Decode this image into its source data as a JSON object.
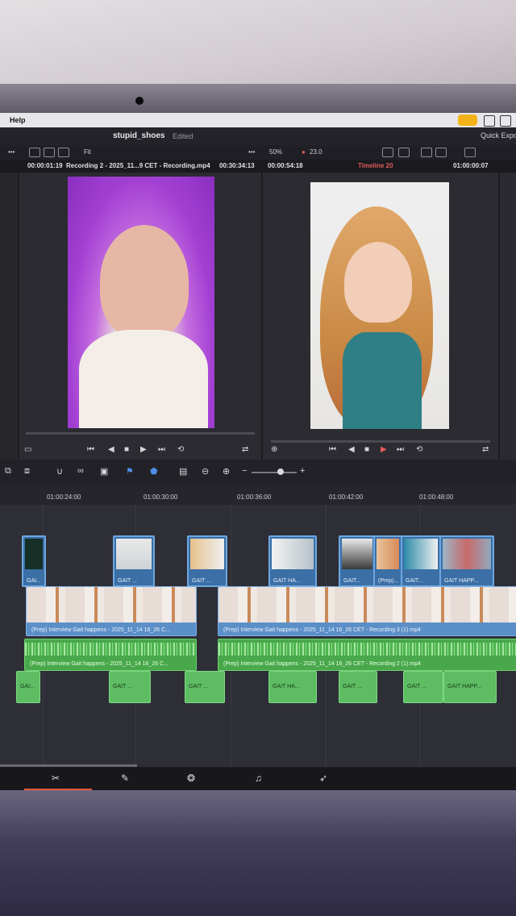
{
  "menubar": {
    "help": "Help"
  },
  "titlebar": {
    "title": "stupid_shoes",
    "status": "Edited",
    "quick_export": "Quick Export"
  },
  "viewer_toolbar": {
    "fit": "Fit",
    "zoom": "50%",
    "fps": "23.0",
    "more": "•••"
  },
  "source_viewer": {
    "timecode": "00:00:01:19",
    "clip_name": "Recording 2 - 2025_11...9 CET - Recording.mp4",
    "duration": "00:30:34:13"
  },
  "program_viewer": {
    "duration": "00:00:54:18",
    "timeline_name": "Timeline 20",
    "timecode": "01:00:00:07"
  },
  "ruler": {
    "ticks": [
      "01:00:24:00",
      "01:00:30:00",
      "01:00:36:00",
      "01:00:42:00",
      "01:00:48:00"
    ]
  },
  "tracks": {
    "video2": [
      "GAI...",
      "GAIT ...",
      "GAIT ...",
      "GAIT HA...",
      "GAIT...",
      "(Prep)...",
      "GAIT...",
      "GAIT HAPP..."
    ],
    "video1": [
      "(Prep) Interview Gait happens - 2025_11_14 16_26 C...",
      "(Prep) Interview Gait happens - 2025_11_14 16_26 CET - Recording 3 (1).mp4"
    ],
    "audio1": [
      "(Prep) Interview Gait happens - 2025_11_14 16_26 C...",
      "(Prep) Interview Gait happens - 2025_11_14 16_26 CET - Recording 2 (1).mp4"
    ],
    "generator": [
      "GAI...",
      "GAIT ...",
      "GAIT ...",
      "GAIT HA...",
      "GAIT ...",
      "GAIT ...",
      "GAIT HAPP..."
    ]
  },
  "icons": {
    "page_cut": "cut-page-icon",
    "page_edit": "edit-page-icon",
    "page_fusion": "fusion-page-icon",
    "page_fairlight": "fairlight-music-icon",
    "page_deliver": "deliver-rocket-icon"
  }
}
